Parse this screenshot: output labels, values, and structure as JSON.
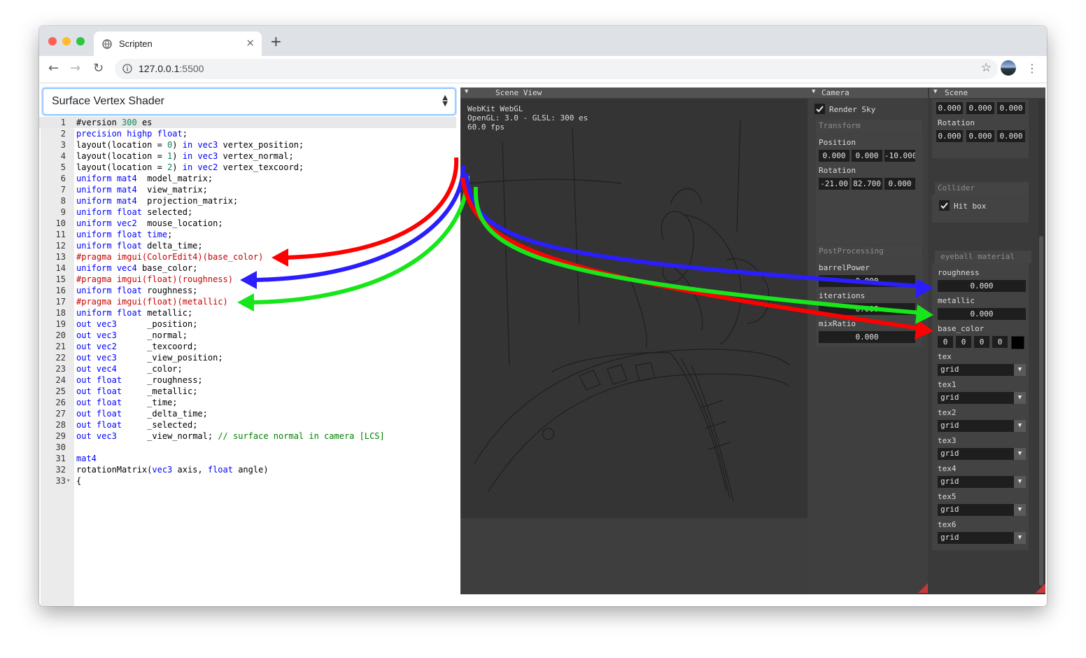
{
  "browser": {
    "tab_title": "Scripten",
    "tab_close": "×",
    "new_tab": "+",
    "url_host": "127.0.0.1",
    "url_port": ":5500",
    "back_icon": "←",
    "forward_icon": "→",
    "reload_icon": "↻",
    "star_icon": "☆",
    "menu_icon": "⋮"
  },
  "editor": {
    "shader_select": "Surface Vertex Shader",
    "lines": [
      {
        "n": "1",
        "tokens": [
          [
            "pl",
            "#version "
          ],
          [
            "num",
            "300"
          ],
          [
            "pl",
            " es"
          ]
        ]
      },
      {
        "n": "2",
        "tokens": [
          [
            "kw",
            "precision"
          ],
          [
            "pl",
            " "
          ],
          [
            "kw",
            "highp"
          ],
          [
            "pl",
            " "
          ],
          [
            "kw",
            "float"
          ],
          [
            "pl",
            ";"
          ]
        ]
      },
      {
        "n": "3",
        "tokens": [
          [
            "pl",
            "layout(location = "
          ],
          [
            "num",
            "0"
          ],
          [
            "pl",
            ") "
          ],
          [
            "kw",
            "in"
          ],
          [
            "pl",
            " "
          ],
          [
            "kw",
            "vec3"
          ],
          [
            "pl",
            " vertex_position;"
          ]
        ]
      },
      {
        "n": "4",
        "tokens": [
          [
            "pl",
            "layout(location = "
          ],
          [
            "num",
            "1"
          ],
          [
            "pl",
            ") "
          ],
          [
            "kw",
            "in"
          ],
          [
            "pl",
            " "
          ],
          [
            "kw",
            "vec3"
          ],
          [
            "pl",
            " vertex_normal;"
          ]
        ]
      },
      {
        "n": "5",
        "tokens": [
          [
            "pl",
            "layout(location = "
          ],
          [
            "num",
            "2"
          ],
          [
            "pl",
            ") "
          ],
          [
            "kw",
            "in"
          ],
          [
            "pl",
            " "
          ],
          [
            "kw",
            "vec2"
          ],
          [
            "pl",
            " vertex_texcoord;"
          ]
        ]
      },
      {
        "n": "6",
        "tokens": [
          [
            "kw",
            "uniform"
          ],
          [
            "pl",
            " "
          ],
          [
            "kw",
            "mat4"
          ],
          [
            "pl",
            "  model_matrix;"
          ]
        ]
      },
      {
        "n": "7",
        "tokens": [
          [
            "kw",
            "uniform"
          ],
          [
            "pl",
            " "
          ],
          [
            "kw",
            "mat4"
          ],
          [
            "pl",
            "  view_matrix;"
          ]
        ]
      },
      {
        "n": "8",
        "tokens": [
          [
            "kw",
            "uniform"
          ],
          [
            "pl",
            " "
          ],
          [
            "kw",
            "mat4"
          ],
          [
            "pl",
            "  projection_matrix;"
          ]
        ]
      },
      {
        "n": "9",
        "tokens": [
          [
            "kw",
            "uniform"
          ],
          [
            "pl",
            " "
          ],
          [
            "kw",
            "float"
          ],
          [
            "pl",
            " selected;"
          ]
        ]
      },
      {
        "n": "10",
        "tokens": [
          [
            "kw",
            "uniform"
          ],
          [
            "pl",
            " "
          ],
          [
            "kw",
            "vec2"
          ],
          [
            "pl",
            "  mouse_location;"
          ]
        ]
      },
      {
        "n": "11",
        "tokens": [
          [
            "kw",
            "uniform"
          ],
          [
            "pl",
            " "
          ],
          [
            "kw",
            "float"
          ],
          [
            "pl",
            " "
          ],
          [
            "kw",
            "time"
          ],
          [
            "pl",
            ";"
          ]
        ]
      },
      {
        "n": "12",
        "tokens": [
          [
            "kw",
            "uniform"
          ],
          [
            "pl",
            " "
          ],
          [
            "kw",
            "float"
          ],
          [
            "pl",
            " delta_time;"
          ]
        ]
      },
      {
        "n": "13",
        "tokens": [
          [
            "prag",
            "#pragma"
          ],
          [
            "pl",
            " "
          ],
          [
            "prag",
            "imgui(ColorEdit4)(base_color)"
          ]
        ]
      },
      {
        "n": "14",
        "tokens": [
          [
            "kw",
            "uniform"
          ],
          [
            "pl",
            " "
          ],
          [
            "kw",
            "vec4"
          ],
          [
            "pl",
            " base_color;"
          ]
        ]
      },
      {
        "n": "15",
        "tokens": [
          [
            "prag",
            "#pragma"
          ],
          [
            "pl",
            " "
          ],
          [
            "prag",
            "imgui(float)(roughness)"
          ]
        ]
      },
      {
        "n": "16",
        "tokens": [
          [
            "kw",
            "uniform"
          ],
          [
            "pl",
            " "
          ],
          [
            "kw",
            "float"
          ],
          [
            "pl",
            " roughness;"
          ]
        ]
      },
      {
        "n": "17",
        "tokens": [
          [
            "prag",
            "#pragma"
          ],
          [
            "pl",
            " "
          ],
          [
            "prag",
            "imgui(float)(metallic)"
          ]
        ]
      },
      {
        "n": "18",
        "tokens": [
          [
            "kw",
            "uniform"
          ],
          [
            "pl",
            " "
          ],
          [
            "kw",
            "float"
          ],
          [
            "pl",
            " metallic;"
          ]
        ]
      },
      {
        "n": "19",
        "tokens": [
          [
            "kw",
            "out"
          ],
          [
            "pl",
            " "
          ],
          [
            "kw",
            "vec3"
          ],
          [
            "pl",
            "      _position;"
          ]
        ]
      },
      {
        "n": "20",
        "tokens": [
          [
            "kw",
            "out"
          ],
          [
            "pl",
            " "
          ],
          [
            "kw",
            "vec3"
          ],
          [
            "pl",
            "      _normal;"
          ]
        ]
      },
      {
        "n": "21",
        "tokens": [
          [
            "kw",
            "out"
          ],
          [
            "pl",
            " "
          ],
          [
            "kw",
            "vec2"
          ],
          [
            "pl",
            "      _texcoord;"
          ]
        ]
      },
      {
        "n": "22",
        "tokens": [
          [
            "kw",
            "out"
          ],
          [
            "pl",
            " "
          ],
          [
            "kw",
            "vec3"
          ],
          [
            "pl",
            "      _view_position;"
          ]
        ]
      },
      {
        "n": "23",
        "tokens": [
          [
            "kw",
            "out"
          ],
          [
            "pl",
            " "
          ],
          [
            "kw",
            "vec4"
          ],
          [
            "pl",
            "      _color;"
          ]
        ]
      },
      {
        "n": "24",
        "tokens": [
          [
            "kw",
            "out"
          ],
          [
            "pl",
            " "
          ],
          [
            "kw",
            "float"
          ],
          [
            "pl",
            "     _roughness;"
          ]
        ]
      },
      {
        "n": "25",
        "tokens": [
          [
            "kw",
            "out"
          ],
          [
            "pl",
            " "
          ],
          [
            "kw",
            "float"
          ],
          [
            "pl",
            "     _metallic;"
          ]
        ]
      },
      {
        "n": "26",
        "tokens": [
          [
            "kw",
            "out"
          ],
          [
            "pl",
            " "
          ],
          [
            "kw",
            "float"
          ],
          [
            "pl",
            "     _time;"
          ]
        ]
      },
      {
        "n": "27",
        "tokens": [
          [
            "kw",
            "out"
          ],
          [
            "pl",
            " "
          ],
          [
            "kw",
            "float"
          ],
          [
            "pl",
            "     _delta_time;"
          ]
        ]
      },
      {
        "n": "28",
        "tokens": [
          [
            "kw",
            "out"
          ],
          [
            "pl",
            " "
          ],
          [
            "kw",
            "float"
          ],
          [
            "pl",
            "     _selected;"
          ]
        ]
      },
      {
        "n": "29",
        "tokens": [
          [
            "kw",
            "out"
          ],
          [
            "pl",
            " "
          ],
          [
            "kw",
            "vec3"
          ],
          [
            "pl",
            "      _view_normal; "
          ],
          [
            "cmt",
            "// surface normal in camera [LCS]"
          ]
        ]
      },
      {
        "n": "30",
        "tokens": []
      },
      {
        "n": "31",
        "tokens": [
          [
            "kw",
            "mat4"
          ]
        ]
      },
      {
        "n": "32",
        "tokens": [
          [
            "pl",
            "rotationMatrix("
          ],
          [
            "kw",
            "vec3"
          ],
          [
            "pl",
            " axis, "
          ],
          [
            "kw",
            "float"
          ],
          [
            "pl",
            " angle)"
          ]
        ]
      },
      {
        "n": "33",
        "tokens": [
          [
            "pl",
            "{"
          ]
        ],
        "fold": "▾"
      }
    ]
  },
  "scene_view": {
    "title": "Scene View",
    "info_line1": "WebKit WebGL",
    "info_line2": "OpenGL: 3.0 - GLSL: 300 es",
    "info_line3": "60.0 fps"
  },
  "camera": {
    "title": "Camera",
    "render_sky_label": "Render Sky",
    "render_sky_checked": true,
    "transform_header": "Transform",
    "position_label": "Position",
    "position": [
      "0.000",
      "0.000",
      "-10.000"
    ],
    "rotation_label": "Rotation",
    "rotation": [
      "-21.00",
      "82.700",
      "0.000"
    ],
    "postprocessing_header": "PostProcessing",
    "barrel_power_label": "barrelPower",
    "barrel_power": "0.000",
    "iterations_label": "iterations",
    "iterations": "0.000",
    "mix_ratio_label": "mixRatio",
    "mix_ratio": "0.000"
  },
  "scene": {
    "title": "Scene",
    "position": [
      "0.000",
      "0.000",
      "0.000"
    ],
    "rotation_label": "Rotation",
    "rotation": [
      "0.000",
      "0.000",
      "0.000"
    ],
    "collider_header": "Collider",
    "hit_box_label": "Hit box",
    "hit_box_checked": true,
    "material_header": "eyeball material",
    "roughness_label": "roughness",
    "roughness": "0.000",
    "metallic_label": "metallic",
    "metallic": "0.000",
    "base_color_label": "base_color",
    "base_color": [
      "0",
      "0",
      "0",
      "0"
    ],
    "base_color_swatch": "#000000",
    "textures": [
      {
        "label": "tex",
        "value": "grid"
      },
      {
        "label": "tex1",
        "value": "grid"
      },
      {
        "label": "tex2",
        "value": "grid"
      },
      {
        "label": "tex3",
        "value": "grid"
      },
      {
        "label": "tex4",
        "value": "grid"
      },
      {
        "label": "tex5",
        "value": "grid"
      },
      {
        "label": "tex6",
        "value": "grid"
      }
    ]
  },
  "colors": {
    "arrow_red": "#ff0000",
    "arrow_blue": "#2a1eff",
    "arrow_green": "#17e61a",
    "accent": "#80bdff"
  }
}
